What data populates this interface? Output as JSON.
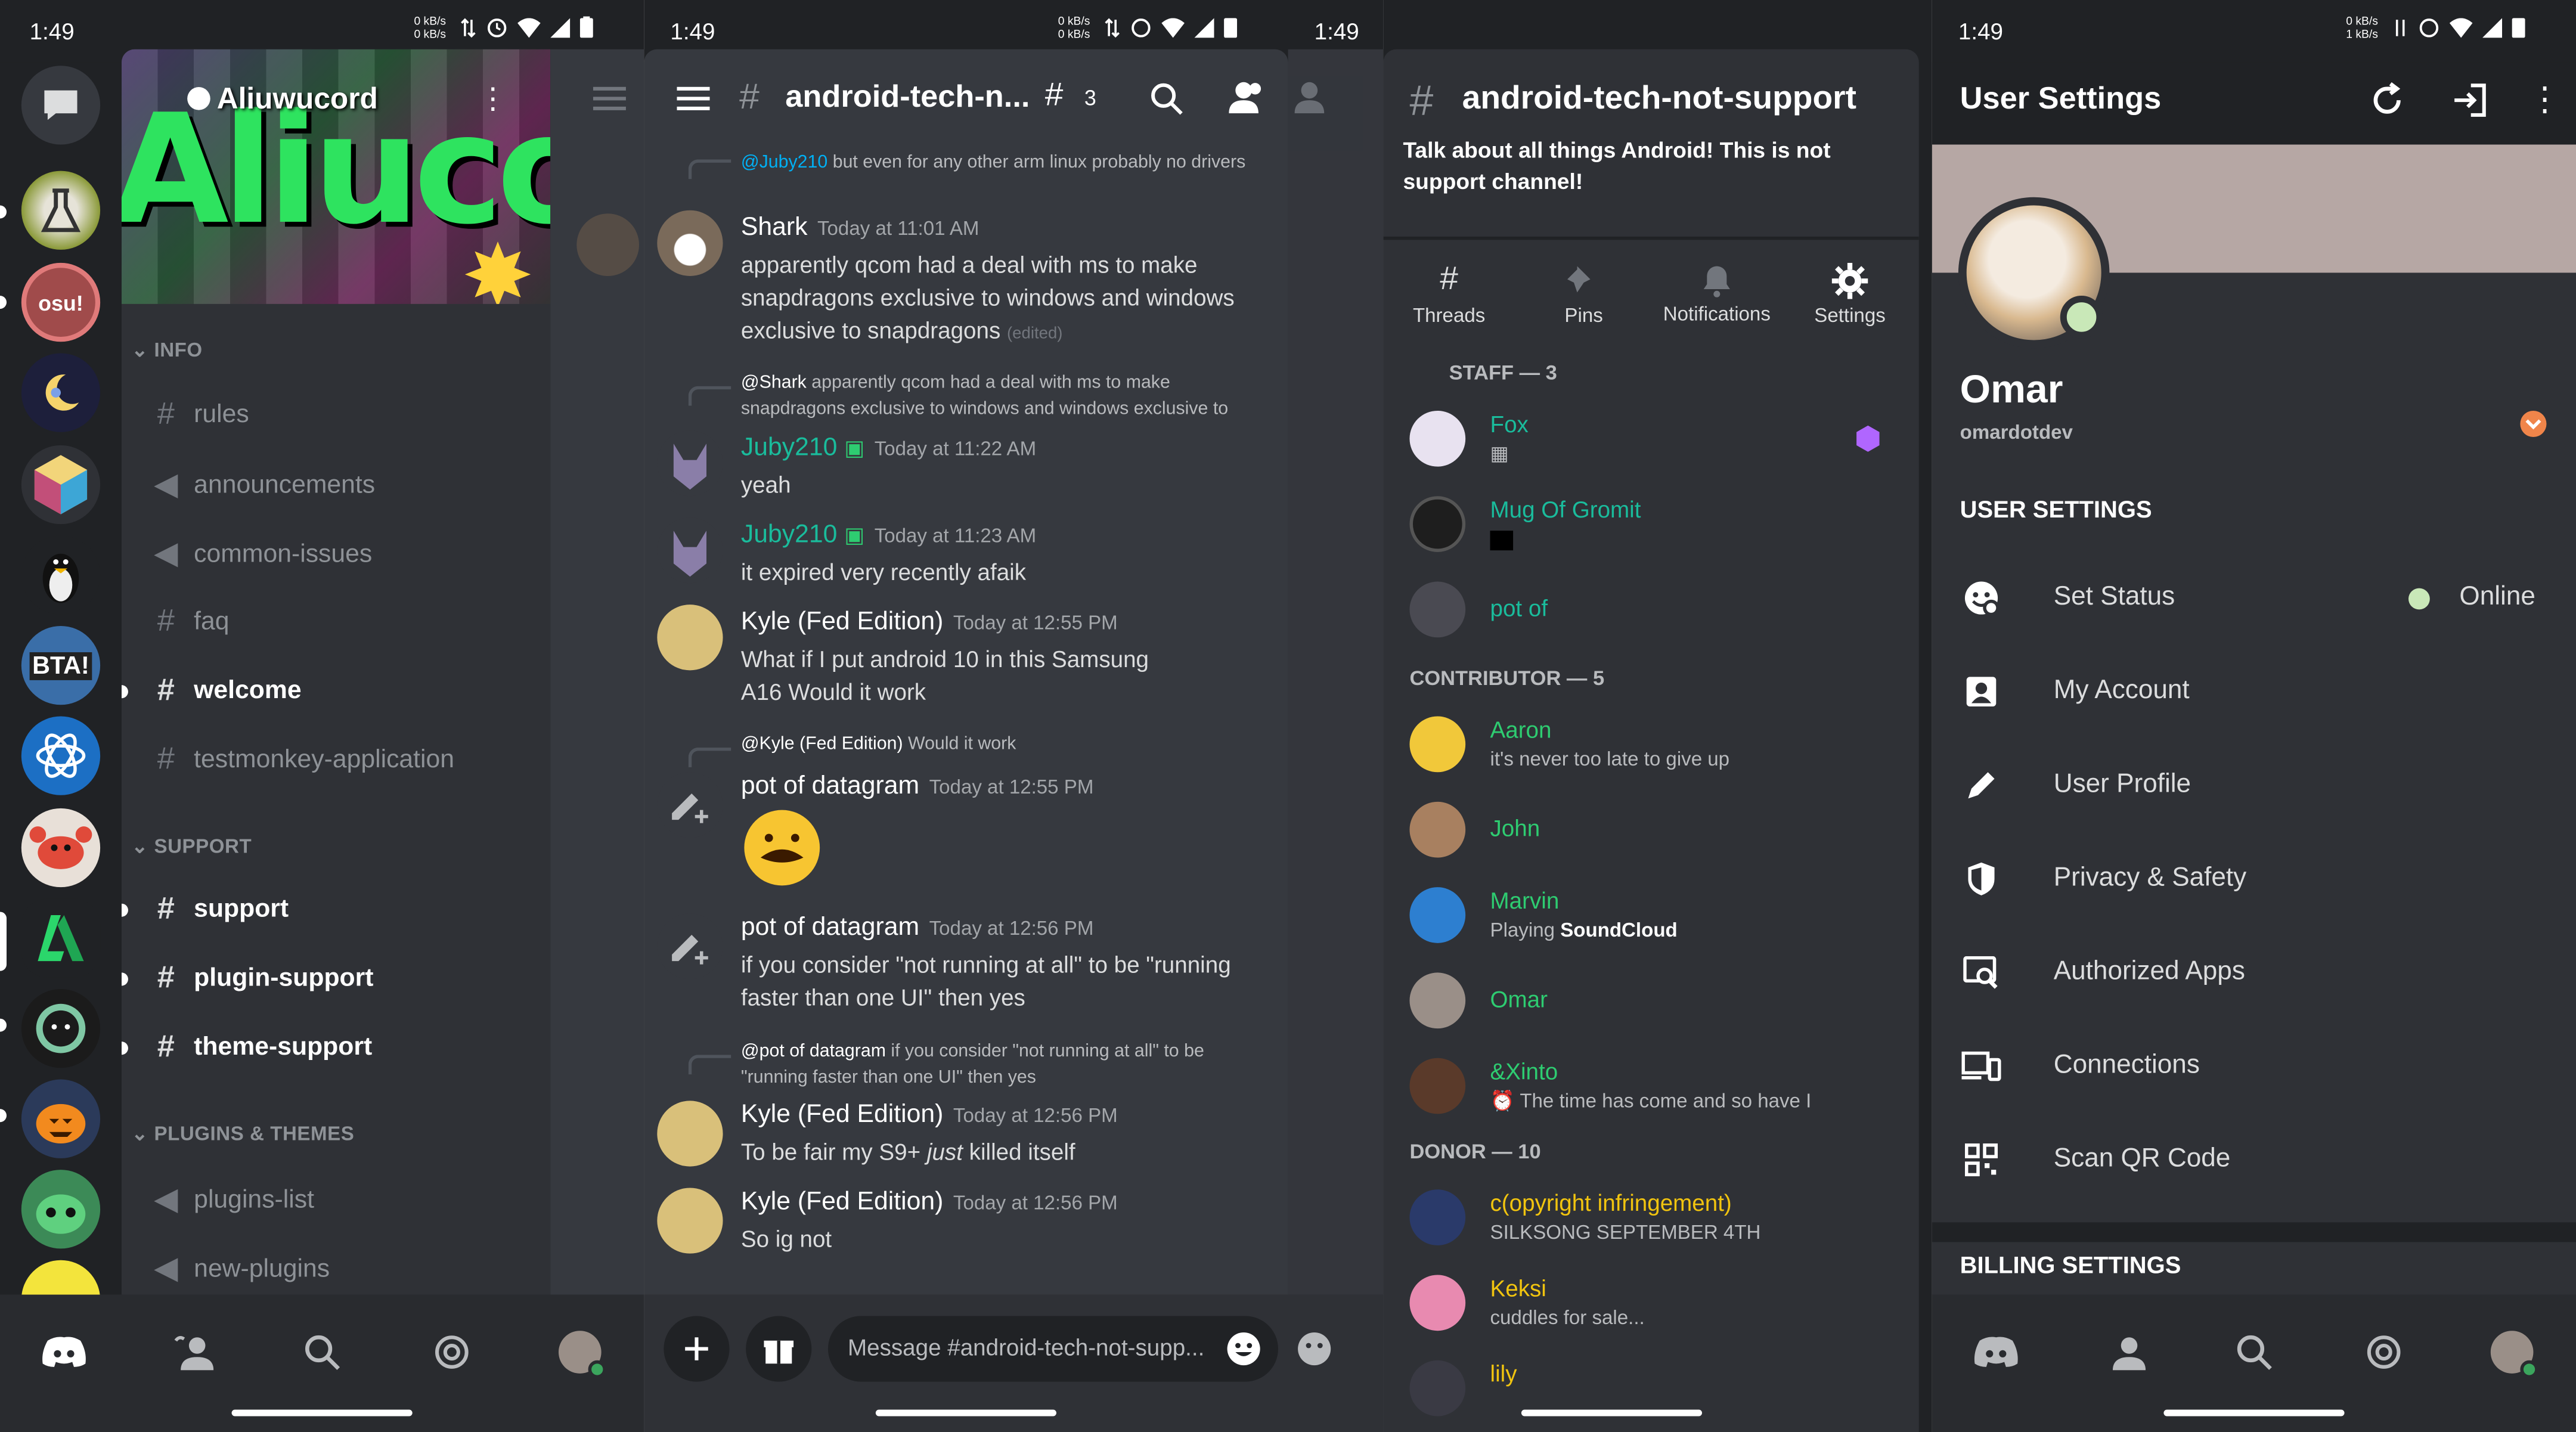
{
  "status_bars": [
    {
      "time": "1:49",
      "net": [
        "0 kB/s",
        "0 kB/s"
      ]
    },
    {
      "time": "1:49",
      "net": [
        "0 kB/s",
        "0 kB/s"
      ]
    },
    {
      "time": "1:49",
      "net": []
    },
    {
      "time": "1:49",
      "net": [
        "0 kB/s",
        "0 kB/s"
      ]
    },
    {
      "time": "1:49",
      "net": [
        "0 kB/s",
        "1 kB/s"
      ]
    }
  ],
  "screen1": {
    "server_name": "Aliuwucord",
    "banner_text": "Aliucord",
    "categories": {
      "info": "INFO",
      "support": "SUPPORT",
      "plugins": "PLUGINS & THEMES"
    },
    "channels": [
      {
        "name": "rules",
        "glyph": "#"
      },
      {
        "name": "announcements",
        "glyph": "📢"
      },
      {
        "name": "common-issues",
        "glyph": "📢"
      },
      {
        "name": "faq",
        "glyph": "#"
      },
      {
        "name": "welcome",
        "glyph": "#"
      },
      {
        "name": "testmonkey-application",
        "glyph": "#"
      },
      {
        "name": "support",
        "glyph": "#"
      },
      {
        "name": "plugin-support",
        "glyph": "#"
      },
      {
        "name": "theme-support",
        "glyph": "#"
      },
      {
        "name": "plugins-list",
        "glyph": "📢"
      },
      {
        "name": "new-plugins",
        "glyph": "📢"
      }
    ],
    "server_labels": [
      "osu!",
      "BTA!"
    ]
  },
  "screen2": {
    "channel_title": "android-tech-n...",
    "thread_count": "3",
    "composer_placeholder": "Message #android-tech-not-supp...",
    "messages": [
      {
        "reply_name": "@Juby210",
        "reply_text": "but even for any other arm linux probably no drivers"
      },
      {
        "author": "Shark",
        "time": "Today at 11:01 AM",
        "text": "apparently qcom had a deal with ms to make snapdragons exclusive to windows and windows exclusive to snapdragons",
        "edited": "(edited)"
      },
      {
        "reply_name": "@Shark",
        "reply_text": "apparently qcom had a deal with ms to make snapdragons exclusive to windows and windows exclusive to"
      },
      {
        "author": "Juby210",
        "time": "Today at 11:22 AM",
        "text": "yeah"
      },
      {
        "author": "Juby210",
        "time": "Today at 11:23 AM",
        "text": "it expired very recently afaik"
      },
      {
        "author": "Kyle (Fed Edition)",
        "time": "Today at 12:55 PM",
        "text": "What if I put android 10 in this Samsung A16 Would it work"
      },
      {
        "reply_name": "@Kyle (Fed Edition)",
        "reply_text": "Would it work"
      },
      {
        "author": "pot of datagram",
        "time": "Today at 12:55 PM",
        "text": ""
      },
      {
        "author": "pot of datagram",
        "time": "Today at 12:56 PM",
        "text": "if you consider \"not running at all\" to be \"running faster than one UI\" then yes"
      },
      {
        "reply_name": "@pot of datagram",
        "reply_text": "if you consider \"not running at all\" to be \"running faster than one UI\" then yes"
      },
      {
        "author": "Kyle (Fed Edition)",
        "time": "Today at 12:56 PM",
        "text_before": "To be fair my S9+ ",
        "text_em": "just",
        "text_after": " killed itself"
      },
      {
        "author": "Kyle (Fed Edition)",
        "time": "Today at 12:56 PM",
        "text": "So ig not"
      }
    ]
  },
  "screen3": {
    "channel_name": "android-tech-not-support",
    "topic": "Talk about all things Android! This is not support channel!",
    "actions": [
      "Threads",
      "Pins",
      "Notifications",
      "Settings"
    ],
    "sections": [
      {
        "label": "STAFF — 3",
        "members": [
          {
            "name": "Fox",
            "status": "",
            "color": "#1abc9c"
          },
          {
            "name": "Mug Of Gromit",
            "status": "",
            "color": "#1abc9c"
          },
          {
            "name": "pot of",
            "status": "",
            "color": "#1abc9c"
          }
        ]
      },
      {
        "label": "CONTRIBUTOR — 5",
        "members": [
          {
            "name": "Aaron",
            "status": "it's never too late to give up",
            "color": "#2ecc71"
          },
          {
            "name": "John",
            "status": "",
            "color": "#2ecc71"
          },
          {
            "name": "Marvin",
            "status_prefix": "Playing ",
            "status_bold": "SoundCloud",
            "color": "#2ecc71"
          },
          {
            "name": "Omar",
            "status": "",
            "color": "#2ecc71"
          },
          {
            "name": "&Xinto",
            "status": "The time has come and so have I",
            "color": "#2ecc71"
          }
        ]
      },
      {
        "label": "DONOR — 10",
        "members": [
          {
            "name": "c(opyright infringement)",
            "status": "SILKSONG SEPTEMBER 4TH",
            "color": "#f1c40f"
          },
          {
            "name": "Keksi",
            "status": "cuddles for sale...",
            "color": "#f1c40f"
          },
          {
            "name": "lily",
            "status": "",
            "color": "#f1c40f"
          }
        ]
      }
    ]
  },
  "screen4": {
    "title": "User Settings",
    "username": "Omar",
    "handle": "omardotdev",
    "section_user": "USER SETTINGS",
    "section_billing": "BILLING SETTINGS",
    "status_value": "Online",
    "items": [
      "Set Status",
      "My Account",
      "User Profile",
      "Privacy & Safety",
      "Authorized Apps",
      "Connections",
      "Scan QR Code"
    ],
    "colors": {
      "online": "#3ba55d",
      "accent": "#faa61a",
      "banner": "#b6a7a4"
    }
  }
}
